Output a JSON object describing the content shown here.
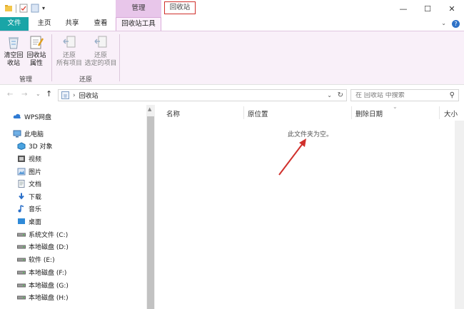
{
  "titlebar": {
    "context_tab": "管理",
    "window_title": "回收站",
    "minimize": "—",
    "maximize": "☐",
    "close": "✕"
  },
  "tabs": {
    "file": "文件",
    "home": "主页",
    "share": "共享",
    "view": "查看",
    "tools": "回收站工具",
    "expand": "⌄"
  },
  "ribbon": {
    "empty_bin": "清空回收站",
    "empty_bin_l1": "清空回",
    "empty_bin_l2": "收站",
    "properties_l1": "回收站",
    "properties_l2": "属性",
    "group_manage": "管理",
    "restore_all_l1": "还原",
    "restore_all_l2": "所有项目",
    "restore_sel_l1": "还原",
    "restore_sel_l2": "选定的项目",
    "group_restore": "还原"
  },
  "nav": {
    "back": "←",
    "forward": "→",
    "recent": "⌄",
    "up": "↑",
    "breadcrumb_sep": "›",
    "location": "回收站",
    "search_placeholder": "在 回收站 中搜索"
  },
  "tree": [
    {
      "label": "WPS网盘",
      "icon": "cloud-icon"
    },
    {
      "label": "此电脑",
      "icon": "computer-icon"
    },
    {
      "label": "3D 对象",
      "icon": "3d-objects-icon"
    },
    {
      "label": "视频",
      "icon": "video-icon"
    },
    {
      "label": "图片",
      "icon": "pictures-icon"
    },
    {
      "label": "文档",
      "icon": "documents-icon"
    },
    {
      "label": "下载",
      "icon": "download-icon"
    },
    {
      "label": "音乐",
      "icon": "music-icon"
    },
    {
      "label": "桌面",
      "icon": "desktop-icon"
    },
    {
      "label": "系统文件 (C:)",
      "icon": "drive-icon"
    },
    {
      "label": "本地磁盘 (D:)",
      "icon": "drive-icon"
    },
    {
      "label": "软件 (E:)",
      "icon": "drive-icon"
    },
    {
      "label": "本地磁盘 (F:)",
      "icon": "drive-icon"
    },
    {
      "label": "本地磁盘 (G:)",
      "icon": "drive-icon"
    },
    {
      "label": "本地磁盘 (H:)",
      "icon": "drive-icon"
    }
  ],
  "columns": {
    "name": "名称",
    "original_location": "原位置",
    "date_deleted": "删除日期",
    "size": "大小"
  },
  "empty_message": "此文件夹为空。",
  "colors": {
    "file_tab": "#19a5a7",
    "context_tab": "#e8c6ea",
    "annotation_red": "#d0302c"
  }
}
